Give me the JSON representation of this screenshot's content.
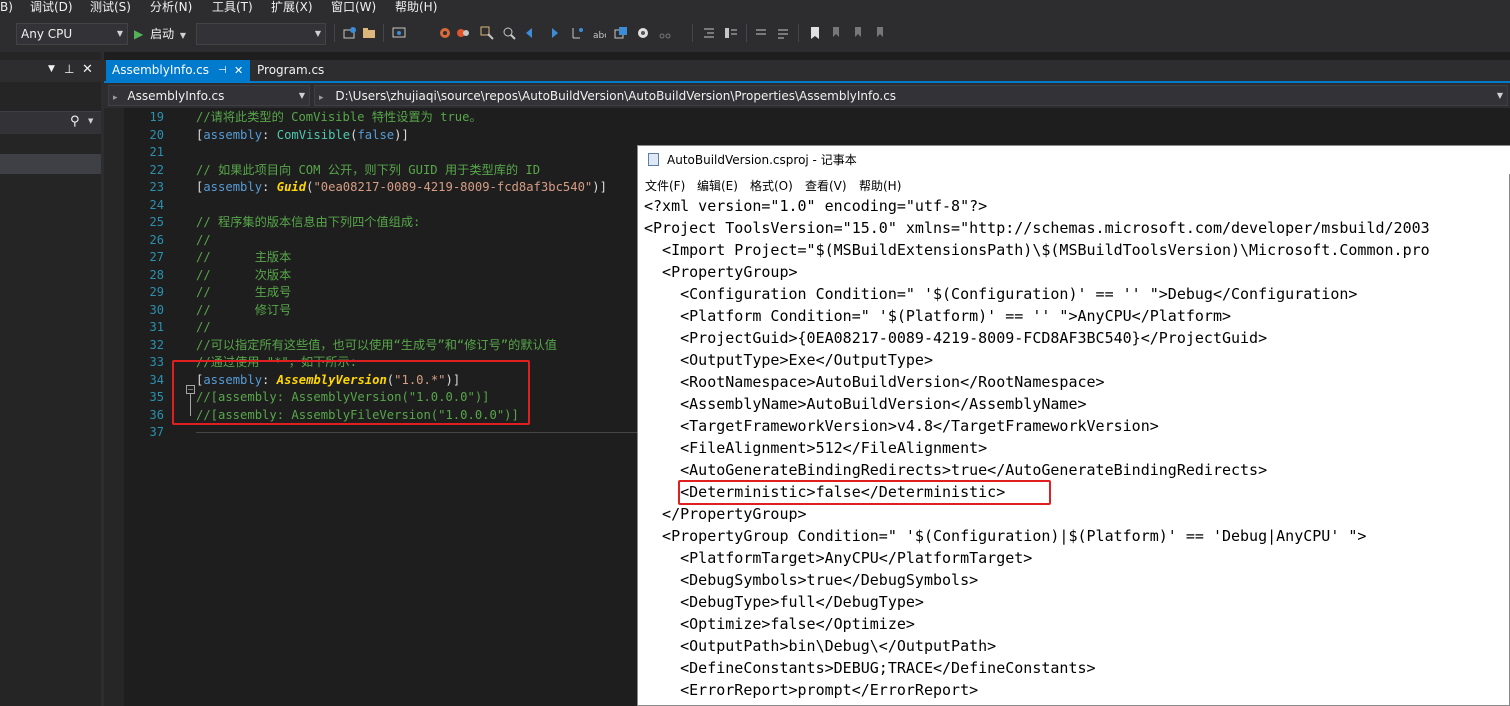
{
  "menu": [
    "B)",
    "调试(D)",
    "测试(S)",
    "分析(N)",
    "工具(T)",
    "扩展(X)",
    "窗口(W)",
    "帮助(H)"
  ],
  "toolbar": {
    "platform": "Any CPU",
    "start_label": "启动",
    "startup_item": ""
  },
  "tabs": [
    {
      "label": "AssemblyInfo.cs",
      "active": true
    },
    {
      "label": "Program.cs",
      "active": false
    }
  ],
  "nav": {
    "file": "AssemblyInfo.cs",
    "path": "D:\\Users\\zhujiaqi\\source\\repos\\AutoBuildVersion\\AutoBuildVersion\\Properties\\AssemblyInfo.cs"
  },
  "editor": {
    "line_numbers": [
      "19",
      "20",
      "21",
      "22",
      "23",
      "24",
      "25",
      "26",
      "27",
      "28",
      "29",
      "30",
      "31",
      "32",
      "33",
      "34",
      "35",
      "36",
      "37"
    ],
    "lines": [
      [
        {
          "c": "cm",
          "t": "//请将此类型的 ComVisible 特性设置为 true。"
        }
      ],
      [
        {
          "c": "br",
          "t": "["
        },
        {
          "c": "kw",
          "t": "assembly"
        },
        {
          "c": "br",
          "t": ": "
        },
        {
          "c": "ty",
          "t": "ComVisible"
        },
        {
          "c": "br",
          "t": "("
        },
        {
          "c": "kw",
          "t": "false"
        },
        {
          "c": "br",
          "t": ")]"
        }
      ],
      [],
      [
        {
          "c": "cm",
          "t": "// 如果此项目向 COM 公开，则下列 GUID 用于类型库的 ID"
        }
      ],
      [
        {
          "c": "br",
          "t": "["
        },
        {
          "c": "kw",
          "t": "assembly"
        },
        {
          "c": "br",
          "t": ": "
        },
        {
          "c": "it",
          "t": "Guid"
        },
        {
          "c": "br",
          "t": "("
        },
        {
          "c": "st",
          "t": "\"0ea08217-0089-4219-8009-fcd8af3bc540\""
        },
        {
          "c": "br",
          "t": ")]"
        }
      ],
      [],
      [
        {
          "c": "cm",
          "t": "// 程序集的版本信息由下列四个值组成:"
        }
      ],
      [
        {
          "c": "cm",
          "t": "//"
        }
      ],
      [
        {
          "c": "cm",
          "t": "//      主版本"
        }
      ],
      [
        {
          "c": "cm",
          "t": "//      次版本"
        }
      ],
      [
        {
          "c": "cm",
          "t": "//      生成号"
        }
      ],
      [
        {
          "c": "cm",
          "t": "//      修订号"
        }
      ],
      [
        {
          "c": "cm",
          "t": "//"
        }
      ],
      [
        {
          "c": "cm",
          "t": "//可以指定所有这些值，也可以使用“生成号”和“修订号”的默认值"
        }
      ],
      [
        {
          "c": "cm",
          "t": "//通过使用 \"*\"，如下所示:"
        }
      ],
      [
        {
          "c": "br",
          "t": "["
        },
        {
          "c": "kw",
          "t": "assembly"
        },
        {
          "c": "br",
          "t": ": "
        },
        {
          "c": "it",
          "t": "AssemblyVersion"
        },
        {
          "c": "br",
          "t": "("
        },
        {
          "c": "st",
          "t": "\"1.0.*\""
        },
        {
          "c": "br",
          "t": ")]"
        }
      ],
      [
        {
          "c": "cm",
          "t": "//[assembly: AssemblyVersion(\"1.0.0.0\")]"
        }
      ],
      [
        {
          "c": "cm",
          "t": "//[assembly: AssemblyFileVersion(\"1.0.0.0\")]"
        }
      ],
      []
    ]
  },
  "notepad": {
    "title": "AutoBuildVersion.csproj - 记事本",
    "menu": [
      "文件(F)",
      "编辑(E)",
      "格式(O)",
      "查看(V)",
      "帮助(H)"
    ],
    "lines": [
      "<?xml version=\"1.0\" encoding=\"utf-8\"?>",
      "<Project ToolsVersion=\"15.0\" xmlns=\"http://schemas.microsoft.com/developer/msbuild/2003",
      "  <Import Project=\"$(MSBuildExtensionsPath)\\$(MSBuildToolsVersion)\\Microsoft.Common.pro",
      "  <PropertyGroup>",
      "    <Configuration Condition=\" '$(Configuration)' == '' \">Debug</Configuration>",
      "    <Platform Condition=\" '$(Platform)' == '' \">AnyCPU</Platform>",
      "    <ProjectGuid>{0EA08217-0089-4219-8009-FCD8AF3BC540}</ProjectGuid>",
      "    <OutputType>Exe</OutputType>",
      "    <RootNamespace>AutoBuildVersion</RootNamespace>",
      "    <AssemblyName>AutoBuildVersion</AssemblyName>",
      "    <TargetFrameworkVersion>v4.8</TargetFrameworkVersion>",
      "    <FileAlignment>512</FileAlignment>",
      "    <AutoGenerateBindingRedirects>true</AutoGenerateBindingRedirects>",
      "    <Deterministic>false</Deterministic>",
      "  </PropertyGroup>",
      "  <PropertyGroup Condition=\" '$(Configuration)|$(Platform)' == 'Debug|AnyCPU' \">",
      "    <PlatformTarget>AnyCPU</PlatformTarget>",
      "    <DebugSymbols>true</DebugSymbols>",
      "    <DebugType>full</DebugType>",
      "    <Optimize>false</Optimize>",
      "    <OutputPath>bin\\Debug\\</OutputPath>",
      "    <DefineConstants>DEBUG;TRACE</DefineConstants>",
      "    <ErrorReport>prompt</ErrorReport>"
    ]
  },
  "colors": {
    "accent": "#007acc",
    "highlight_box": "#e02020"
  }
}
